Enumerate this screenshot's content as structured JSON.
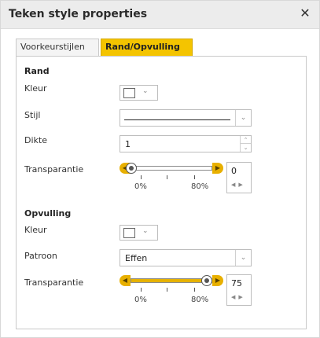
{
  "dialog": {
    "title": "Teken style properties",
    "close_icon": "close-icon"
  },
  "tabs": [
    {
      "label": "Voorkeurstijlen",
      "active": false
    },
    {
      "label": "Rand/Opvulling",
      "active": true
    }
  ],
  "border": {
    "heading": "Rand",
    "color_label": "Kleur",
    "color_value": "#ffffff",
    "style_label": "Stijl",
    "style_value": "solid",
    "thickness_label": "Dikte",
    "thickness_value": "1",
    "transparency_label": "Transparantie",
    "transparency_value": "0",
    "transparency_fraction": 0,
    "scale_min": "0%",
    "scale_max": "80%"
  },
  "fill": {
    "heading": "Opvulling",
    "color_label": "Kleur",
    "color_value": "#ffffff",
    "pattern_label": "Patroon",
    "pattern_value": "Effen",
    "transparency_label": "Transparantie",
    "transparency_value": "75",
    "transparency_fraction": 0.9375,
    "scale_min": "0%",
    "scale_max": "80%"
  },
  "colors": {
    "accent": "#f4c400",
    "slider_fill": "#e6b200"
  }
}
